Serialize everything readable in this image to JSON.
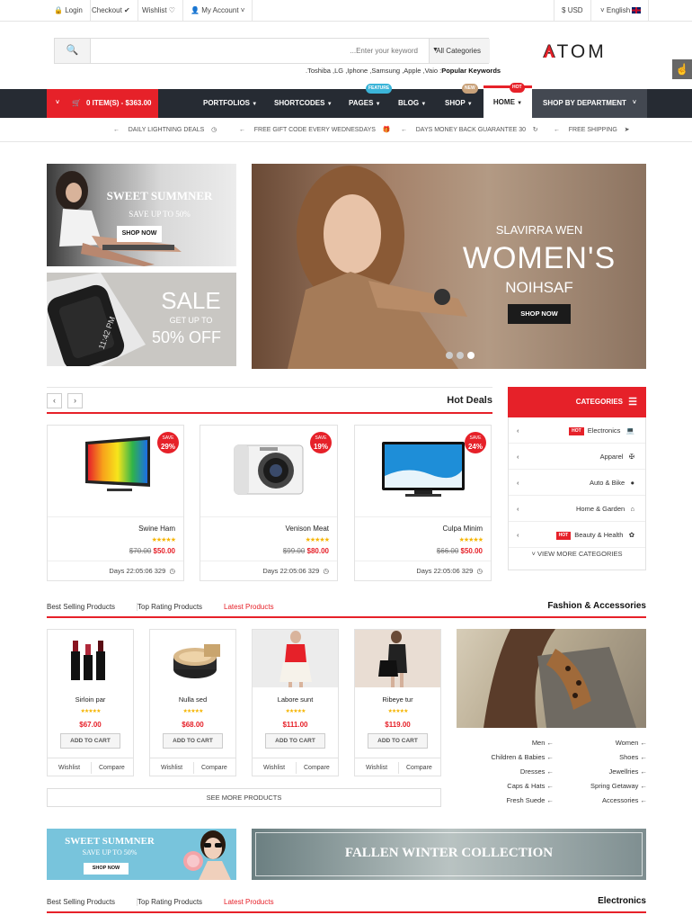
{
  "topbar": {
    "login": "Login",
    "checkout": "Checkout",
    "wishlist": "Wishlist",
    "my_account": "My Account",
    "currency": "USD",
    "language": "English"
  },
  "search": {
    "placeholder": "...Enter your keyword",
    "category": "All Categories",
    "popular_prefix": ".Toshiba ,LG ,Iphone ,Samsung ,Apple ,Vaio :",
    "popular_label": "Popular Keywords"
  },
  "logo": {
    "text": "ATOM"
  },
  "nav": {
    "cart": "0 ITEM(S) - $363.00",
    "items": [
      "PORTFOLIOS",
      "SHORTCODES",
      "PAGES",
      "BLOG",
      "SHOP",
      "HOME"
    ],
    "shop_by_department": "SHOP BY DEPARTMENT",
    "tags": {
      "pages": "FEATURE",
      "shop": "NEW",
      "home": "HOT"
    }
  },
  "promo": [
    "DAILY LIGHTNING DEALS",
    "FREE GIFT CODE EVERY WEDNESDAYS",
    "DAYS MONEY BACK GUARANTEE 30",
    "FREE SHIPPING"
  ],
  "banners": {
    "sweet_title": "SWEET SUMMNER",
    "sweet_sub": "SAVE UP TO 50%",
    "shop_now": "SHOP NOW",
    "sale_title": "SALE",
    "sale_sub": "GET UP TO",
    "sale_off": "50% OFF",
    "hero_line1": "SLAVIRRA WEN",
    "hero_line2": "WOMEN'S",
    "hero_line3": "NOIHSAF",
    "hero_button": "SHOP NOW",
    "watch_time": "11:42 PM"
  },
  "hot_deals": {
    "title": "Hot Deals",
    "save_label": "SAVE",
    "items": [
      {
        "name": "Swine Ham",
        "old": "$70.00",
        "new": "$50.00",
        "save": "29%",
        "timer": "Days 22:05:06 329"
      },
      {
        "name": "Venison Meat",
        "old": "$99.00",
        "new": "$80.00",
        "save": "19%",
        "timer": "Days 22:05:06 329"
      },
      {
        "name": "Culpa Minim",
        "old": "$66.00",
        "new": "$50.00",
        "save": "24%",
        "timer": "Days 22:05:06 329"
      }
    ]
  },
  "categories": {
    "title": "CATEGORIES",
    "hot_label": "HOT",
    "items": [
      "Electronics",
      "Apparel",
      "Auto & Bike",
      "Home & Garden",
      "Beauty & Health"
    ],
    "view_more": "VIEW MORE CATEGORIES"
  },
  "fashion": {
    "tabs": [
      "Best Selling Products",
      "Top Rating Products",
      "Latest Products"
    ],
    "title": "Fashion & Accessories",
    "add_to_cart": "ADD TO CART",
    "wishlist": "Wishlist",
    "compare": "Compare",
    "products": [
      {
        "name": "Sirloin par",
        "price": "$67.00"
      },
      {
        "name": "Nulla sed",
        "price": "$68.00"
      },
      {
        "name": "Labore sunt",
        "price": "$111.00"
      },
      {
        "name": "Ribeye tur",
        "price": "$119.00"
      }
    ],
    "see_more": "SEE MORE PRODUCTS",
    "cats_left": [
      "Men",
      "Children & Babies",
      "Dresses",
      "Caps & Hats",
      "Fresh Suede"
    ],
    "cats_right": [
      "Women",
      "Shoes",
      "Jewellries",
      "Spring Getaway",
      "Accessories"
    ]
  },
  "bottom_banners": {
    "sweet_title": "SWEET SUMMNER",
    "sweet_sub": "SAVE UP TO 50%",
    "shop_now": "SHOP NOW",
    "winter": "FALLEN WINTER COLLECTION"
  },
  "electronics": {
    "tabs": [
      "Best Selling Products",
      "Top Rating Products",
      "Latest Products"
    ],
    "title": "Electronics"
  },
  "colors": {
    "accent": "#e62129",
    "nav_bg": "#262b33"
  }
}
